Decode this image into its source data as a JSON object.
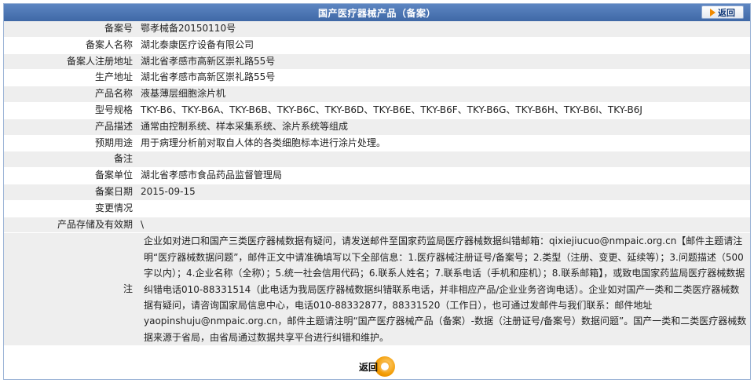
{
  "header": {
    "title": "国产医疗器械产品（备案）",
    "back_label": "返回"
  },
  "rows": [
    {
      "key": "备案号",
      "value": "鄂孝械备20150110号"
    },
    {
      "key": "备案人名称",
      "value": "湖北泰康医疗设备有限公司"
    },
    {
      "key": "备案人注册地址",
      "value": "湖北省孝感市高新区崇礼路55号"
    },
    {
      "key": "生产地址",
      "value": "湖北省孝感市高新区崇礼路55号"
    },
    {
      "key": "产品名称",
      "value": "液基薄层细胞涂片机"
    },
    {
      "key": "型号规格",
      "value": "TKY-B6、TKY-B6A、TKY-B6B、TKY-B6C、TKY-B6D、TKY-B6E、TKY-B6F、TKY-B6G、TKY-B6H、TKY-B6I、TKY-B6J"
    },
    {
      "key": "产品描述",
      "value": "通常由控制系统、样本采集系统、涂片系统等组成"
    },
    {
      "key": "预期用途",
      "value": "用于病理分析前对取自人体的各类细胞标本进行涂片处理。"
    },
    {
      "key": "备注",
      "value": ""
    },
    {
      "key": "备案单位",
      "value": "湖北省孝感市食品药品监督管理局"
    },
    {
      "key": "备案日期",
      "value": "2015-09-15"
    },
    {
      "key": "变更情况",
      "value": ""
    }
  ],
  "storage": {
    "key": "产品存储及有效期",
    "value": "\\"
  },
  "note": {
    "key": "注",
    "text": "企业如对进口和国产三类医疗器械数据有疑问，请发送邮件至国家药监局医疗器械数据纠错邮箱：qixiejiucuo@nmpaic.org.cn【邮件主题请注明“医疗器械数据问题”，邮件正文中请准确填写以下全部信息：1.医疗器械注册证号/备案号；2.类型（注册、变更、延续等）；3.问题描述（500字以内）；4.企业名称（全称）；5.统一社会信用代码；6.联系人姓名；7.联系电话（手机和座机）；8.联系邮箱】，或致电国家药监局医疗器械数据纠错电话010-88331514（此电话为我局医疗器械数据纠错联系电话，并非相应产品/企业业务咨询电话）。企业如对国产一类和二类医疗器械数据有疑问，请咨询国家局信息中心，电话010-88332877，88331520（工作日），也可通过发邮件与我们联系：邮件地址yaopinshuju@nmpaic.org.cn，邮件主题请注明“国产医疗器械产品（备案）-数据（注册证号/备案号）数据问题”。国产一类和二类医疗器械数据来源于省局，由省局通过数据共享平台进行纠错和维护。"
  },
  "footer": {
    "back_label": "返回"
  }
}
